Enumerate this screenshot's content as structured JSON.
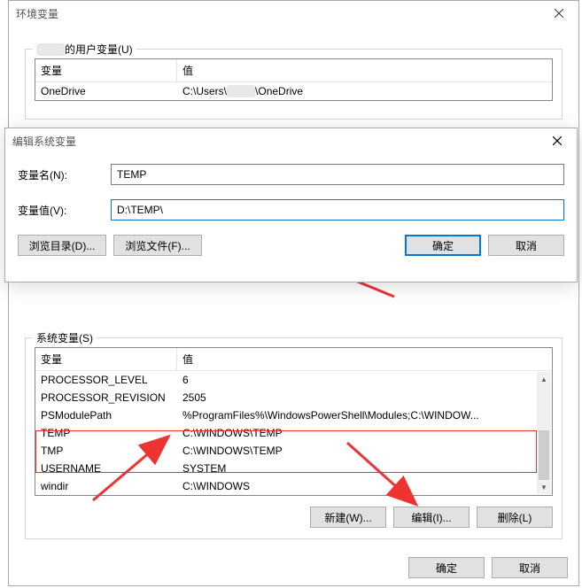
{
  "env_window": {
    "title": "环境变量",
    "user_vars_title": "的用户变量(U)",
    "user_table": {
      "col_var": "变量",
      "col_val": "值",
      "rows": [
        {
          "name": "OneDrive",
          "value_prefix": "C:\\Users\\",
          "value_suffix": "\\OneDrive"
        }
      ]
    },
    "sys_vars_title": "系统变量(S)",
    "sys_table": {
      "col_var": "变量",
      "col_val": "值",
      "rows": [
        {
          "name": "PROCESSOR_LEVEL",
          "value": "6"
        },
        {
          "name": "PROCESSOR_REVISION",
          "value": "2505"
        },
        {
          "name": "PSModulePath",
          "value": "%ProgramFiles%\\WindowsPowerShell\\Modules;C:\\WINDOW..."
        },
        {
          "name": "TEMP",
          "value": "C:\\WINDOWS\\TEMP"
        },
        {
          "name": "TMP",
          "value": "C:\\WINDOWS\\TEMP"
        },
        {
          "name": "USERNAME",
          "value": "SYSTEM"
        },
        {
          "name": "windir",
          "value": "C:\\WINDOWS"
        }
      ]
    },
    "buttons": {
      "new": "新建(W)...",
      "edit": "编辑(I)...",
      "delete": "删除(L)",
      "ok": "确定",
      "cancel": "取消"
    }
  },
  "edit_window": {
    "title": "编辑系统变量",
    "name_label": "变量名(N):",
    "name_value": "TEMP",
    "value_label": "变量值(V):",
    "value_value": "D:\\TEMP\\",
    "browse_dir": "浏览目录(D)...",
    "browse_file": "浏览文件(F)...",
    "ok": "确定",
    "cancel": "取消"
  }
}
